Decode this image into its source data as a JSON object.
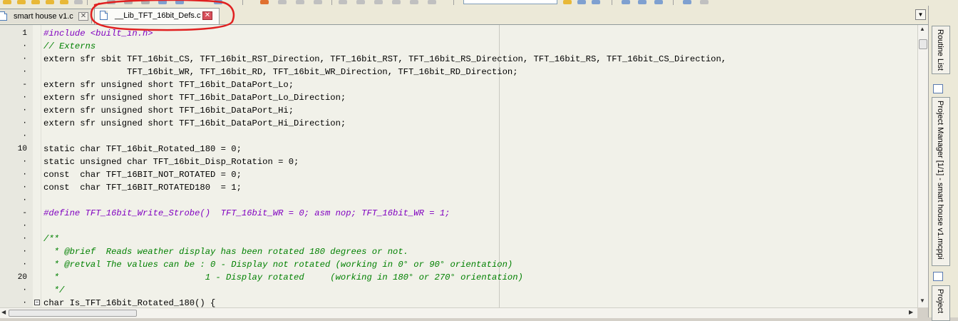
{
  "tabs": [
    {
      "label": "smart house v1.c",
      "active": false
    },
    {
      "label": "__Lib_TFT_16bit_Defs.c",
      "active": true
    }
  ],
  "close_glyph": "✕",
  "fold_glyph": "−",
  "dropdown_glyph": "▼",
  "side_panels": [
    {
      "label": "Routine List"
    },
    {
      "label": "Project Manager [1/1] - smart house v1.mcppi"
    },
    {
      "label": "Project"
    }
  ],
  "lines": [
    {
      "num": "1",
      "text": "#include <built_in.h>",
      "style": "pre"
    },
    {
      "num": "·",
      "text": "// Externs",
      "style": "comment"
    },
    {
      "num": "·",
      "text": "extern sfr sbit TFT_16bit_CS, TFT_16bit_RST_Direction, TFT_16bit_RST, TFT_16bit_RS_Direction, TFT_16bit_RS, TFT_16bit_CS_Direction,",
      "style": "code"
    },
    {
      "num": "·",
      "text": "                TFT_16bit_WR, TFT_16bit_RD, TFT_16bit_WR_Direction, TFT_16bit_RD_Direction;",
      "style": "code"
    },
    {
      "num": "-",
      "text": "extern sfr unsigned short TFT_16bit_DataPort_Lo;",
      "style": "code"
    },
    {
      "num": "·",
      "text": "extern sfr unsigned short TFT_16bit_DataPort_Lo_Direction;",
      "style": "code"
    },
    {
      "num": "·",
      "text": "extern sfr unsigned short TFT_16bit_DataPort_Hi;",
      "style": "code"
    },
    {
      "num": "·",
      "text": "extern sfr unsigned short TFT_16bit_DataPort_Hi_Direction;",
      "style": "code"
    },
    {
      "num": "·",
      "text": "",
      "style": "code"
    },
    {
      "num": "10",
      "text": "static char TFT_16bit_Rotated_180 = 0;",
      "style": "code"
    },
    {
      "num": "·",
      "text": "static unsigned char TFT_16bit_Disp_Rotation = 0;",
      "style": "code"
    },
    {
      "num": "·",
      "text": "const  char TFT_16BIT_NOT_ROTATED = 0;",
      "style": "code"
    },
    {
      "num": "·",
      "text": "const  char TFT_16BIT_ROTATED180  = 1;",
      "style": "code"
    },
    {
      "num": "·",
      "text": "",
      "style": "code"
    },
    {
      "num": "-",
      "text": "#define TFT_16bit_Write_Strobe()  TFT_16bit_WR = 0; asm nop; TFT_16bit_WR = 1;",
      "style": "pre"
    },
    {
      "num": "·",
      "text": "",
      "style": "code"
    },
    {
      "num": "·",
      "text": "/**",
      "style": "comment"
    },
    {
      "num": "·",
      "text": "  * @brief  Reads weather display has been rotated 180 degrees or not.",
      "style": "comment"
    },
    {
      "num": "·",
      "text": "  * @retval The values can be : 0 - Display not rotated (working in 0° or 90° orientation)",
      "style": "comment"
    },
    {
      "num": "20",
      "text": "  *                            1 - Display rotated     (working in 180° or 270° orientation)",
      "style": "comment"
    },
    {
      "num": "·",
      "text": "  */",
      "style": "comment"
    },
    {
      "num": "·",
      "text": "char Is_TFT_16bit_Rotated_180() {",
      "style": "code",
      "fold": true
    }
  ]
}
